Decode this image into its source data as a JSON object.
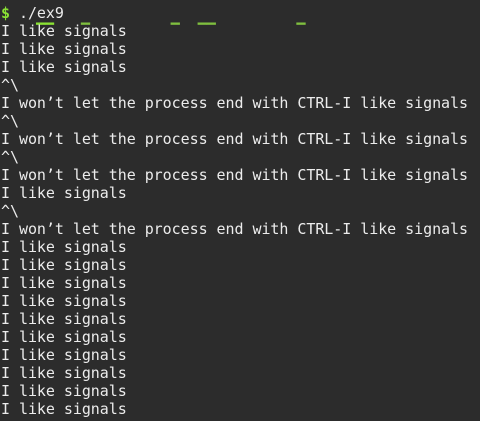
{
  "terminal": {
    "prompt_symbol": "$",
    "command": "./ex9",
    "output_lines": [
      "I like signals",
      "I like signals",
      "I like signals",
      "^\\",
      "I won’t let the process end with CTRL-I like signals",
      "^\\",
      "I won’t let the process end with CTRL-I like signals",
      "^\\",
      "I won’t let the process end with CTRL-I like signals",
      "I like signals",
      "^\\",
      "I won’t let the process end with CTRL-I like signals",
      "I like signals",
      "I like signals",
      "I like signals",
      "I like signals",
      "I like signals",
      "I like signals",
      "I like signals",
      "I like signals",
      "I like signals",
      "I like signals"
    ]
  },
  "colors": {
    "background": "#2c2c2c",
    "text": "#ececec",
    "prompt": "#8ae234"
  }
}
